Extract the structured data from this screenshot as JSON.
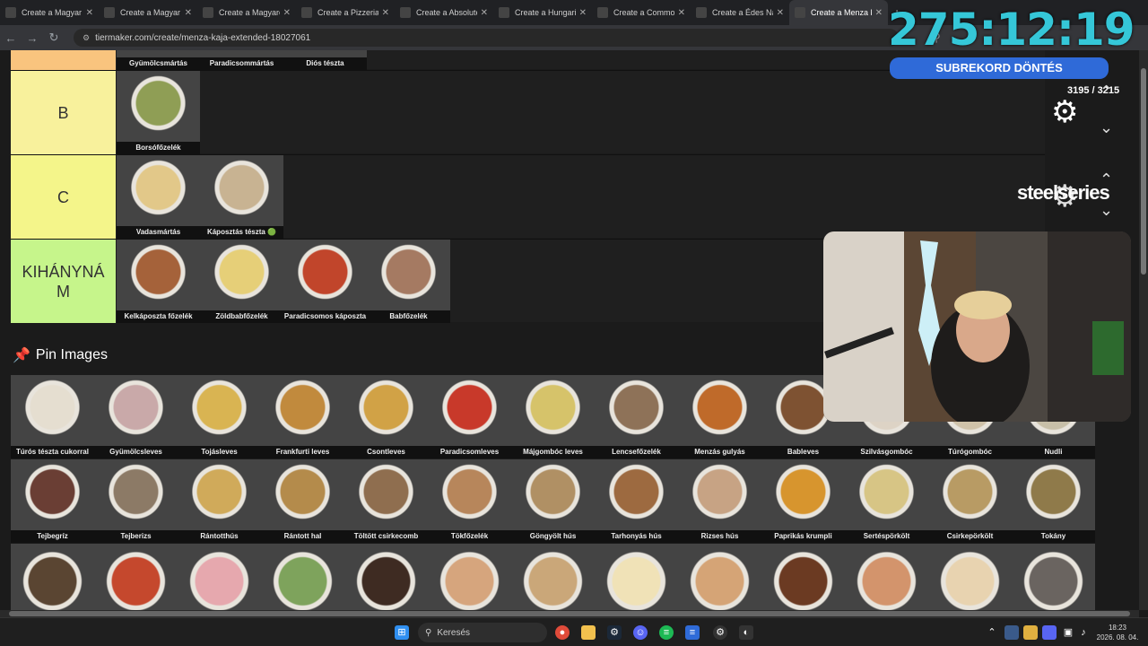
{
  "browser": {
    "tabs": [
      {
        "title": "Create a Magyar I"
      },
      {
        "title": "Create a Magyar I"
      },
      {
        "title": "Create a Magyarc"
      },
      {
        "title": "Create a Pizzerias"
      },
      {
        "title": "Create a Absolute"
      },
      {
        "title": "Create a Hungaric"
      },
      {
        "title": "Create a Commor"
      },
      {
        "title": "Create a Édes Na"
      },
      {
        "title": "Create a Menza k"
      }
    ],
    "url": "tiermaker.com/create/menza-kaja-extended-18027061"
  },
  "tiers": [
    {
      "label": "",
      "color": "#f9c47e",
      "items": [
        {
          "name": "Gyümölcsmártás",
          "color": "#d8c9a8"
        },
        {
          "name": "Paradicsommártás",
          "color": "#cc6644"
        },
        {
          "name": "Diós tészta",
          "color": "#b59a72"
        }
      ]
    },
    {
      "label": "B",
      "color": "#f8f19c",
      "items": [
        {
          "name": "Borsófőzelék",
          "color": "#8f9e55"
        }
      ]
    },
    {
      "label": "C",
      "color": "#f4f58a",
      "items": [
        {
          "name": "Vadasmártás",
          "color": "#e2c889"
        },
        {
          "name": "Káposztás tészta 🟢",
          "color": "#c8b392"
        }
      ]
    },
    {
      "label": "KIHÁNYNÁ M",
      "color": "#c6f58b",
      "items": [
        {
          "name": "Kelkáposzta főzelék",
          "color": "#a5623a"
        },
        {
          "name": "Zöldbabfőzelék",
          "color": "#e6cf78"
        },
        {
          "name": "Paradicsomos káposzta",
          "color": "#c1452b"
        },
        {
          "name": "Babfőzelék",
          "color": "#a57a62"
        }
      ]
    }
  ],
  "pin": {
    "title": "Pin Images"
  },
  "pin_rows": [
    [
      {
        "name": "Túrós tészta cukorral",
        "color": "#e5ded0"
      },
      {
        "name": "Gyümölcsleves",
        "color": "#c9a9a9"
      },
      {
        "name": "Tojásleves",
        "color": "#d9b452"
      },
      {
        "name": "Frankfurti leves",
        "color": "#c18a3d"
      },
      {
        "name": "Csontleves",
        "color": "#d1a246"
      },
      {
        "name": "Paradicsomleves",
        "color": "#c8392a"
      },
      {
        "name": "Májgombóc leves",
        "color": "#d6c36a"
      },
      {
        "name": "Lencsefőzelék",
        "color": "#8e7258"
      },
      {
        "name": "Menzás gulyás",
        "color": "#bf6a2a"
      },
      {
        "name": "Bableves",
        "color": "#7e5232"
      },
      {
        "name": "Szilvásgombóc",
        "color": "#ddd3c5"
      },
      {
        "name": "Túrógombóc",
        "color": "#cfc2a9"
      },
      {
        "name": "Nudli",
        "color": "#c7bfa8"
      }
    ],
    [
      {
        "name": "Tejbegríz",
        "color": "#6a3e34"
      },
      {
        "name": "Tejberizs",
        "color": "#8c7a66"
      },
      {
        "name": "Rántotthús",
        "color": "#d0aa5a"
      },
      {
        "name": "Rántott hal",
        "color": "#b48b4b"
      },
      {
        "name": "Töltött csirkecomb",
        "color": "#8f6e4f"
      },
      {
        "name": "Tökfőzelék",
        "color": "#b7865b"
      },
      {
        "name": "Göngyölt hús",
        "color": "#b09064"
      },
      {
        "name": "Tarhonyás hús",
        "color": "#9d6a40"
      },
      {
        "name": "Rizses hús",
        "color": "#c7a384"
      },
      {
        "name": "Paprikás krumpli",
        "color": "#d7952e"
      },
      {
        "name": "Sertéspörkölt",
        "color": "#d7c585"
      },
      {
        "name": "Csirkepörkölt",
        "color": "#b89b64"
      },
      {
        "name": "Tokány",
        "color": "#8f7a4a"
      }
    ],
    [
      {
        "name": "",
        "color": "#5a4532"
      },
      {
        "name": "",
        "color": "#c5482d"
      },
      {
        "name": "",
        "color": "#e6a8ae"
      },
      {
        "name": "",
        "color": "#7ea35c"
      },
      {
        "name": "",
        "color": "#3e2b22"
      },
      {
        "name": "",
        "color": "#d6a57d"
      },
      {
        "name": "",
        "color": "#caa779"
      },
      {
        "name": "",
        "color": "#f0e2b7"
      },
      {
        "name": "",
        "color": "#d5a476"
      },
      {
        "name": "",
        "color": "#6b3a22"
      },
      {
        "name": "",
        "color": "#d3946c"
      },
      {
        "name": "",
        "color": "#e8d3b0"
      },
      {
        "name": "",
        "color": "#6a6460"
      }
    ]
  ],
  "stream": {
    "timer": "275:12:19",
    "subrekord": "SUBREKORD DÖNTÉS",
    "counter": "3195 / 3215",
    "sponsor": "steelseries"
  },
  "taskbar": {
    "search": "Keresés",
    "time": "18:23",
    "date": "2026. 08. 04."
  }
}
